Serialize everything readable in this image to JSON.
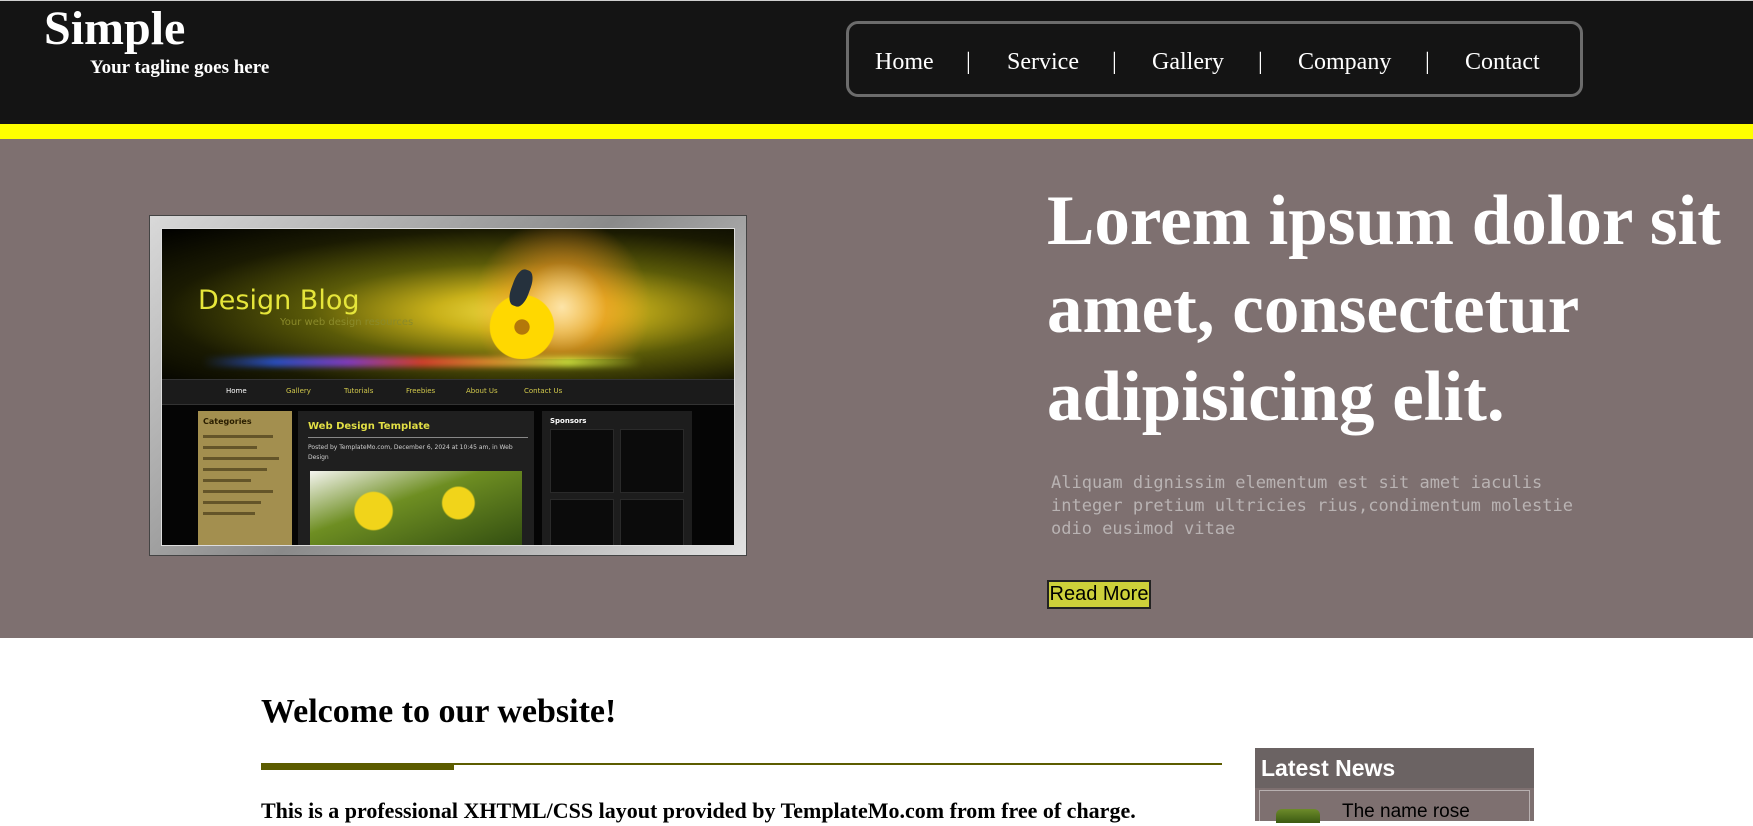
{
  "site": {
    "logo": "Simple",
    "tagline": "Your tagline goes here"
  },
  "nav": {
    "items": [
      "Home",
      "Service",
      "Gallery",
      "Company",
      "Contact"
    ],
    "separator": "|"
  },
  "colors": {
    "header_bg": "#141414",
    "accent_bar": "#ffff00",
    "hero_bg": "#7e7070",
    "button_bg": "#cdd03a",
    "rule": "#5c5c00"
  },
  "hero": {
    "title": "Lorem ipsum dolor sit amet, consectetur adipisicing elit.",
    "description": "Aliquam dignissim elementum est sit amet iaculis integer pretium ultricies rius,condimentum molestie odio eusimod vitae",
    "button_label": "Read More",
    "preview": {
      "title": "Design Blog",
      "subtitle": "Your web design resources",
      "nav": [
        "Home",
        "Gallery",
        "Tutorials",
        "Freebies",
        "About Us",
        "Contact Us"
      ],
      "categories_title": "Categories",
      "post_title": "Web Design Template",
      "post_meta": "Posted by TemplateMo.com, December 6, 2024 at 10:45 am, in Web Design",
      "sponsors_title": "Sponsors"
    }
  },
  "content": {
    "welcome": "Welcome to our website!",
    "intro": "This is a professional XHTML/CSS layout provided by TemplateMo.com from free of charge."
  },
  "news": {
    "title": "Latest News",
    "items": [
      {
        "title": "The name rose"
      }
    ]
  }
}
